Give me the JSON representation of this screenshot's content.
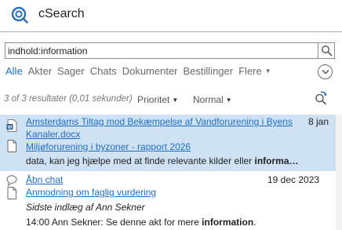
{
  "app": {
    "title": "cSearch",
    "accent_color": "#1e6fc8"
  },
  "search": {
    "query": "indhold:information"
  },
  "tabs": [
    {
      "label": "Alle",
      "active": true
    },
    {
      "label": "Akter",
      "active": false
    },
    {
      "label": "Sager",
      "active": false
    },
    {
      "label": "Chats",
      "active": false
    },
    {
      "label": "Dokumenter",
      "active": false
    },
    {
      "label": "Bestillinger",
      "active": false
    }
  ],
  "more_tab": {
    "label": "Flere"
  },
  "toolbar": {
    "result_count": "3 of 3 resultater (0,01 sekunder)",
    "sort_priority": "Prioritet",
    "sort_normal": "Normal"
  },
  "results": [
    {
      "title_line1": "Amsterdams Tiltag mod Bekæmpelse af Vandforurening i Byens",
      "title_line2": "Kanaler.docx",
      "date": "8 jan",
      "sub_title": "Miljøforurening i byzoner - rapport 2026",
      "snippet_pre": "data, kan jeg hjælpe med at finde relevante kilder eller ",
      "snippet_bold": "informa…",
      "icons": [
        "word-document-icon",
        "document-icon"
      ],
      "selected": true
    },
    {
      "title_line1": "Åbn chat",
      "date": "19 dec 2023",
      "sub_title": "Anmodning om faglig vurdering",
      "meta": "Sidste indlæg af Ann Sekner",
      "snippet_pre": "14:00 Ann Sekner: Se denne akt for mere ",
      "snippet_bold": "information",
      "snippet_post": ".",
      "icons": [
        "chat-icon",
        "document-icon"
      ],
      "selected": false
    }
  ]
}
